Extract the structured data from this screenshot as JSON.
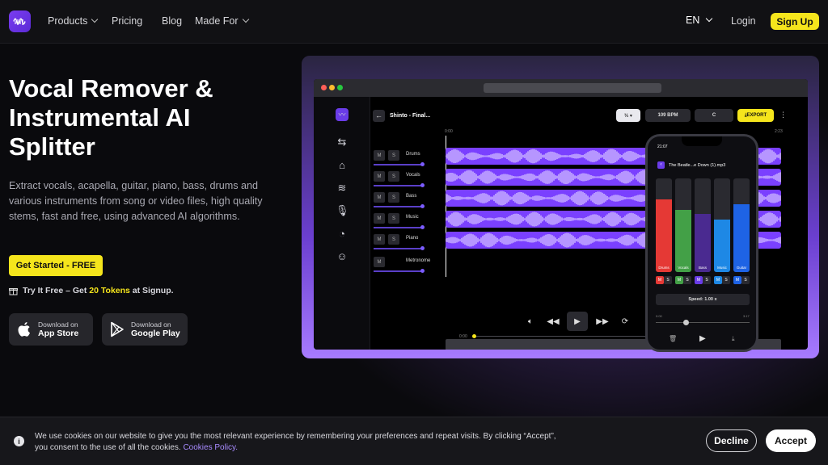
{
  "nav": {
    "products": "Products",
    "pricing": "Pricing",
    "blog": "Blog",
    "made_for": "Made For",
    "language": "EN",
    "login": "Login",
    "signup": "Sign Up"
  },
  "hero": {
    "title": "Vocal Remover & Instrumental AI Splitter",
    "description": "Extract vocals, acapella, guitar, piano, bass, drums and various instruments from song or video files, high quality stems, fast and free, using advanced AI algorithms.",
    "cta": "Get Started - FREE",
    "try_prefix": "Try It Free – Get ",
    "try_highlight": "20 Tokens",
    "try_suffix": " at Signup.",
    "app_store_small": "Download on",
    "app_store_big": "App Store",
    "google_play_small": "Download on",
    "google_play_big": "Google Play"
  },
  "mockup": {
    "song_title": "Shinto - Final...",
    "key": "C",
    "bpm": "109 BPM",
    "export": "EXPORT",
    "time_start": "0:00",
    "time_end": "2:23",
    "tracks": [
      {
        "name": "Drums",
        "m": "M",
        "s": "S"
      },
      {
        "name": "Vocals",
        "m": "M",
        "s": "S"
      },
      {
        "name": "Bass",
        "m": "M",
        "s": "S"
      },
      {
        "name": "Music",
        "m": "M",
        "s": "S"
      },
      {
        "name": "Piano",
        "m": "M",
        "s": "S"
      },
      {
        "name": "Metronome",
        "m": "M",
        "s": ""
      }
    ],
    "playback_time": "0:00",
    "accent_color": "#7a40ff"
  },
  "phone": {
    "clock": "21:07",
    "file": "The Beatle...e Down (1).mp3",
    "stems": [
      {
        "name": "Drums",
        "color": "#e53935",
        "level": 0.78
      },
      {
        "name": "Vocals",
        "color": "#43a047",
        "level": 0.66
      },
      {
        "name": "Bass",
        "color": "#4a2a90",
        "level": 0.62
      },
      {
        "name": "Music",
        "color": "#1e88e5",
        "level": 0.56
      },
      {
        "name": "Guitar",
        "color": "#1e63e5",
        "level": 0.72
      }
    ],
    "speed": "Speed: 1.00 x",
    "pos_start": "0:00",
    "pos_end": "3:17"
  },
  "cookie": {
    "text": "We use cookies on our website to give you the most relevant experience by remembering your preferences and repeat visits. By clicking “Accept”, you consent to the use of all the cookies. ",
    "link": "Cookies Policy.",
    "decline": "Decline",
    "accept": "Accept"
  }
}
